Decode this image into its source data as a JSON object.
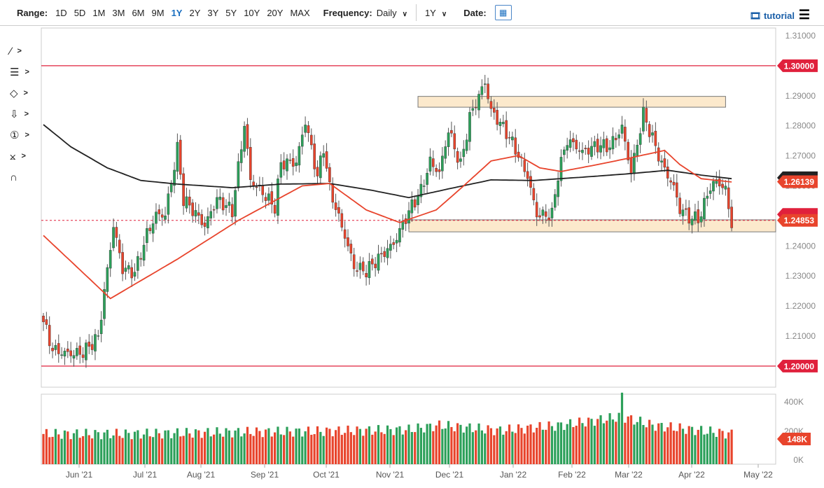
{
  "toolbar": {
    "range_label": "Range:",
    "ranges": [
      "1D",
      "5D",
      "1M",
      "3M",
      "6M",
      "9M",
      "1Y",
      "2Y",
      "3Y",
      "5Y",
      "10Y",
      "20Y",
      "MAX"
    ],
    "active_range": "1Y",
    "frequency_label": "Frequency:",
    "frequency_value": "Daily",
    "period_value": "1Y",
    "date_label": "Date:",
    "tutorial_label": "tutorial"
  },
  "tools": [
    "trendline-icon",
    "fibonacci-icon",
    "shapes-icon",
    "arrow-down-icon",
    "number-marker-icon",
    "measure-icon",
    "magnet-icon"
  ],
  "colors": {
    "up": "#2ca05a",
    "down": "#e8442c",
    "ma_fast": "#e8442c",
    "ma_slow": "#222222",
    "hline": "#e0203c",
    "zone": "#fce9cc"
  },
  "chart_data": {
    "type": "candlestick",
    "ylim": [
      1.195,
      1.312
    ],
    "y_ticks": [
      "1.31000",
      "1.30000",
      "1.29000",
      "1.28000",
      "1.27000",
      "1.26000",
      "1.25000",
      "1.24000",
      "1.23000",
      "1.22000",
      "1.21000",
      "1.20000"
    ],
    "x_ticks": [
      "Jun '21",
      "Jul '21",
      "Aug '21",
      "Sep '21",
      "Oct '21",
      "Nov '21",
      "Dec '21",
      "Jan '22",
      "Feb '22",
      "Mar '22",
      "Apr '22",
      "May '22"
    ],
    "close_waypoints": [
      [
        0,
        1.2147
      ],
      [
        3,
        1.2065
      ],
      [
        13,
        1.2053
      ],
      [
        18,
        1.2088
      ],
      [
        23,
        1.245
      ],
      [
        26,
        1.231
      ],
      [
        30,
        1.231
      ],
      [
        34,
        1.245
      ],
      [
        37,
        1.252
      ],
      [
        40,
        1.252
      ],
      [
        44,
        1.273
      ],
      [
        46,
        1.2555
      ],
      [
        53,
        1.245
      ],
      [
        57,
        1.2543
      ],
      [
        62,
        1.252
      ],
      [
        66,
        1.282
      ],
      [
        68,
        1.2636
      ],
      [
        72,
        1.259
      ],
      [
        76,
        1.2531
      ],
      [
        78,
        1.267
      ],
      [
        83,
        1.266
      ],
      [
        86,
        1.28
      ],
      [
        90,
        1.2624
      ],
      [
        92,
        1.273
      ],
      [
        94,
        1.26
      ],
      [
        99,
        1.245
      ],
      [
        102,
        1.2345
      ],
      [
        106,
        1.232
      ],
      [
        111,
        1.2356
      ],
      [
        115,
        1.239
      ],
      [
        121,
        1.253
      ],
      [
        124,
        1.259
      ],
      [
        127,
        1.2695
      ],
      [
        130,
        1.266
      ],
      [
        133,
        1.28
      ],
      [
        137,
        1.267
      ],
      [
        140,
        1.282
      ],
      [
        145,
        1.2928
      ],
      [
        147,
        1.2834
      ],
      [
        152,
        1.2776
      ],
      [
        155,
        1.273
      ],
      [
        159,
        1.2648
      ],
      [
        162,
        1.252
      ],
      [
        167,
        1.2508
      ],
      [
        169,
        1.2636
      ],
      [
        172,
        1.2741
      ],
      [
        177,
        1.2695
      ],
      [
        182,
        1.273
      ],
      [
        186,
        1.274
      ],
      [
        190,
        1.2811
      ],
      [
        193,
        1.266
      ],
      [
        197,
        1.2846
      ],
      [
        200,
        1.2753
      ],
      [
        203,
        1.266
      ],
      [
        207,
        1.2578
      ],
      [
        209,
        1.2508
      ],
      [
        213,
        1.2485
      ],
      [
        216,
        1.2508
      ],
      [
        218,
        1.259
      ],
      [
        221,
        1.2636
      ],
      [
        224,
        1.26
      ],
      [
        226,
        1.2485
      ]
    ],
    "ma_fast": [
      [
        0,
        1.2435
      ],
      [
        22,
        1.2225
      ],
      [
        44,
        1.2356
      ],
      [
        64,
        1.2485
      ],
      [
        85,
        1.26
      ],
      [
        94,
        1.2608
      ],
      [
        106,
        1.252
      ],
      [
        117,
        1.2478
      ],
      [
        129,
        1.252
      ],
      [
        138,
        1.26
      ],
      [
        147,
        1.2683
      ],
      [
        156,
        1.2701
      ],
      [
        163,
        1.266
      ],
      [
        170,
        1.2648
      ],
      [
        182,
        1.2671
      ],
      [
        193,
        1.2694
      ],
      [
        204,
        1.2718
      ],
      [
        209,
        1.2671
      ],
      [
        216,
        1.2624
      ],
      [
        226,
        1.2613
      ]
    ],
    "ma_slow": [
      [
        0,
        1.2804
      ],
      [
        9,
        1.273
      ],
      [
        21,
        1.266
      ],
      [
        32,
        1.2618
      ],
      [
        44,
        1.2606
      ],
      [
        62,
        1.2594
      ],
      [
        78,
        1.2606
      ],
      [
        94,
        1.2608
      ],
      [
        108,
        1.2585
      ],
      [
        120,
        1.2561
      ],
      [
        133,
        1.259
      ],
      [
        147,
        1.262
      ],
      [
        161,
        1.2618
      ],
      [
        177,
        1.2629
      ],
      [
        193,
        1.2641
      ],
      [
        205,
        1.2652
      ],
      [
        216,
        1.2636
      ],
      [
        226,
        1.2624
      ]
    ],
    "horizontal_lines": [
      1.3,
      1.2
    ],
    "zones": [
      {
        "from_day": 123,
        "to_day": 224,
        "top": 1.2898,
        "bottom": 1.2862
      },
      {
        "from_day": 120,
        "to_day": 999,
        "top": 1.2487,
        "bottom": 1.2447
      }
    ],
    "last_price": "1.24853",
    "ma_label": "1.26139",
    "horizontal_labels": [
      "1.30000",
      "1.20000"
    ],
    "volume": {
      "ylim": [
        0,
        420000
      ],
      "ticks": [
        "400K",
        "200K",
        "0K"
      ],
      "last": "148K",
      "waypoints": [
        [
          0,
          150
        ],
        [
          30,
          150
        ],
        [
          60,
          160
        ],
        [
          90,
          165
        ],
        [
          120,
          175
        ],
        [
          130,
          200
        ],
        [
          150,
          170
        ],
        [
          170,
          200
        ],
        [
          190,
          250
        ],
        [
          200,
          200
        ],
        [
          226,
          150
        ]
      ]
    }
  }
}
